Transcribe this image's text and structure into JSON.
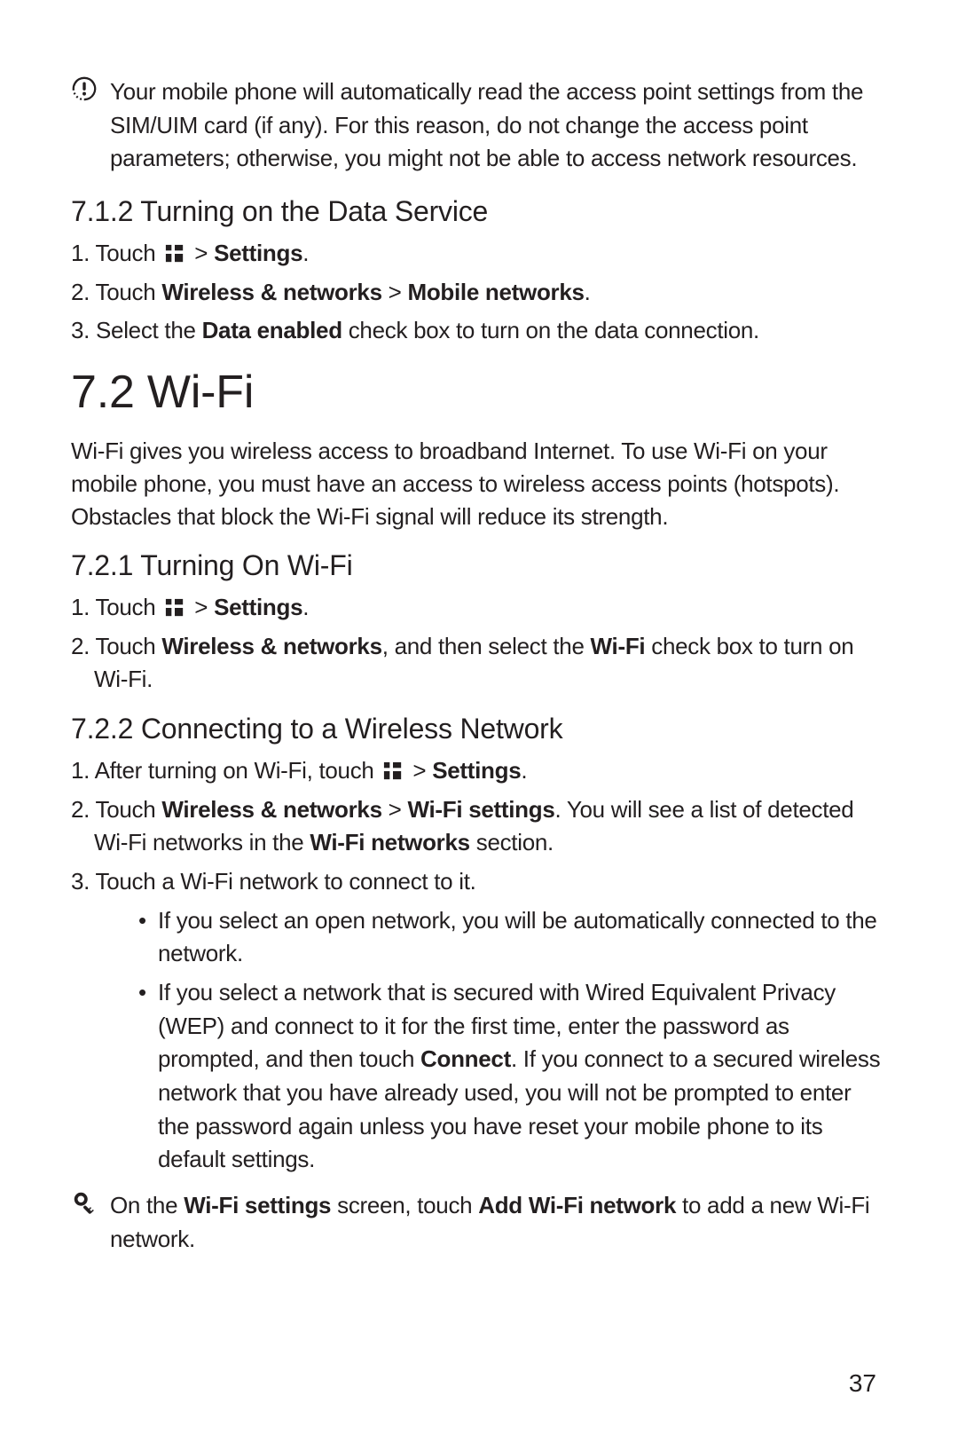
{
  "note1_pre": "Your mobile phone will automatically read the access point settings from the SIM/UIM card (if any). For this reason, do not change the access point parameters; otherwise, you might not be able to access network resources.",
  "h_712": "7.1.2  Turning on the Data Service",
  "s712_1_a": "1. Touch ",
  "s712_1_b": " > ",
  "s712_1_c": "Settings",
  "s712_1_d": ".",
  "s712_2_a": "2. Touch ",
  "s712_2_b": "Wireless & networks",
  "s712_2_c": " > ",
  "s712_2_d": "Mobile networks",
  "s712_2_e": ".",
  "s712_3_a": "3. Select the ",
  "s712_3_b": "Data enabled",
  "s712_3_c": " check box to turn on the data connection.",
  "h_72": "7.2  Wi-Fi",
  "p_72": "Wi-Fi gives you wireless access to broadband Internet. To use Wi-Fi on your mobile phone, you must have an access to wireless access points (hotspots). Obstacles that block the Wi-Fi signal will reduce its strength.",
  "h_721": "7.2.1  Turning On Wi-Fi",
  "s721_1_a": "1. Touch ",
  "s721_1_b": " > ",
  "s721_1_c": "Settings",
  "s721_1_d": ".",
  "s721_2_a": "2. Touch ",
  "s721_2_b": "Wireless & networks",
  "s721_2_c": ", and then select the ",
  "s721_2_d": "Wi-Fi",
  "s721_2_e": " check box to turn on Wi-Fi.",
  "h_722": "7.2.2  Connecting to a Wireless Network",
  "s722_1_a": "1. After turning on Wi-Fi, touch ",
  "s722_1_b": " > ",
  "s722_1_c": "Settings",
  "s722_1_d": ".",
  "s722_2_a": "2. Touch ",
  "s722_2_b": "Wireless & networks",
  "s722_2_c": " > ",
  "s722_2_d": "Wi-Fi settings",
  "s722_2_e": ". You will see a list of detected Wi-Fi networks in the ",
  "s722_2_f": "Wi-Fi networks",
  "s722_2_g": " section.",
  "s722_3": "3. Touch a Wi-Fi network to connect to it.",
  "s722_b1": "If you select an open network, you will be automatically connected to the network.",
  "s722_b2_a": "If you select a network that is secured with Wired Equivalent Privacy (WEP) and connect to it for the first time, enter the password as prompted, and then touch ",
  "s722_b2_b": "Connect",
  "s722_b2_c": ". If you connect to a secured wireless network that you have already used, you will not be prompted to enter the password again unless you have reset your mobile phone to its default settings.",
  "tip_a": "On the ",
  "tip_b": "Wi-Fi settings",
  "tip_c": " screen, touch ",
  "tip_d": "Add Wi-Fi network",
  "tip_e": " to add a new Wi-Fi network.",
  "page_number": "37"
}
